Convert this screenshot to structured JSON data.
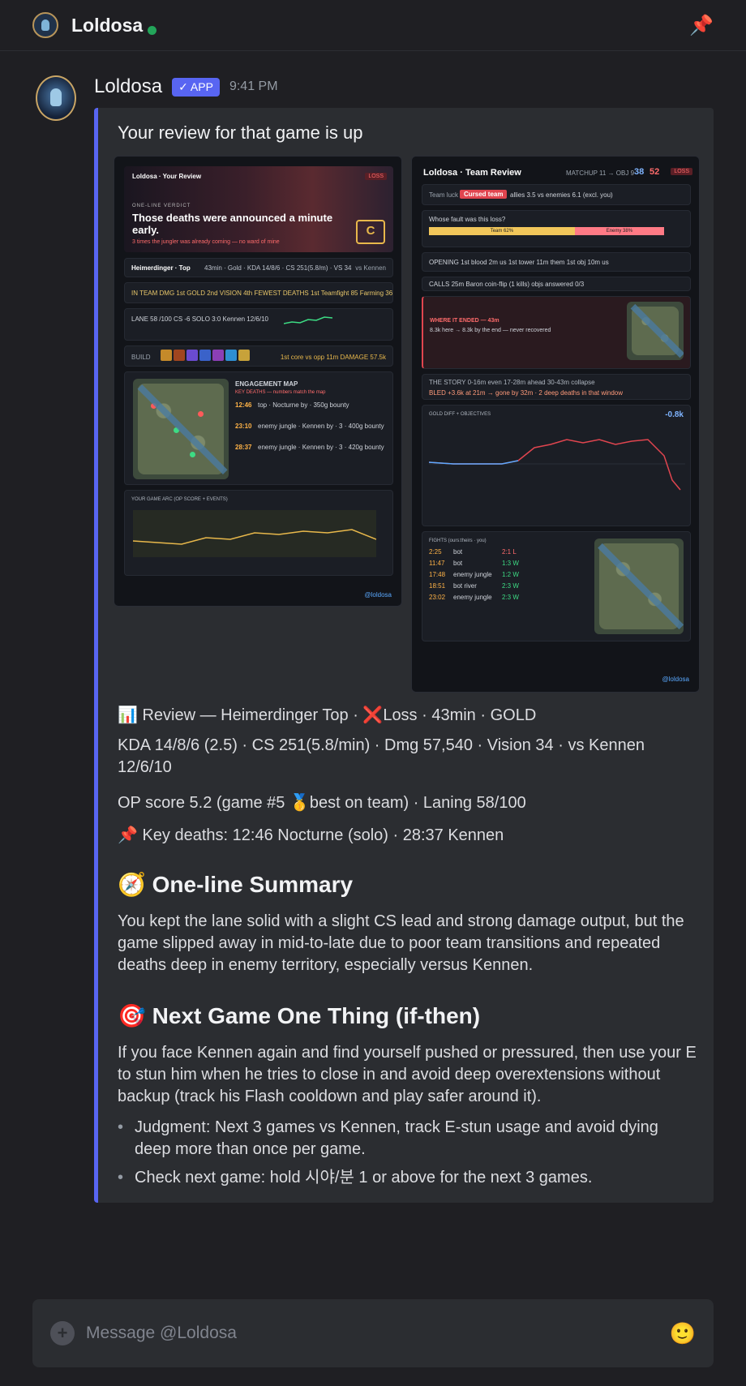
{
  "topbar": {
    "title": "Loldosa"
  },
  "message": {
    "author": "Loldosa",
    "badge": "✓ APP",
    "time": "9:41 PM",
    "intro": "Your review for that game is up",
    "stats_line1": "📊 Review — Heimerdinger Top · ❌Loss · 43min · GOLD",
    "stats_line2": "KDA 14/8/6 (2.5) · CS 251(5.8/min) · Dmg 57,540 · Vision 34 · vs Kennen 12/6/10",
    "stats_line3": "OP score 5.2 (game #5 🥇best on team) · Laning 58/100",
    "stats_line4": "📌 Key deaths: 12:46 Nocturne (solo) · 28:37 Kennen",
    "summary_heading": "One-line Summary",
    "summary_icon": "🧭",
    "summary_text": "You kept the lane solid with a slight CS lead and strong damage output, but the game slipped away in mid-to-late due to poor team transitions and repeated deaths deep in enemy territory, especially versus Kennen.",
    "next_heading": "Next Game One Thing (if-then)",
    "next_icon": "🎯",
    "next_text": "If you face Kennen again and find yourself pushed or pressured, then use your E to stun him when he tries to close in and avoid deep overextensions without backup (track his Flash cooldown and play safer around it).",
    "bullets": [
      "Judgment: Next 3 games vs Kennen, track E-stun usage and avoid dying deep more than once per game.",
      "Check next game: hold 시야/분 1 or above for the next 3 games."
    ]
  },
  "card1": {
    "brand": "Loldosa · Your Review",
    "loss": "LOSS",
    "verdict_label": "ONE-LINE VERDICT",
    "verdict": "Those deaths were announced a minute early.",
    "verdict_sub": "3 times the jungler was already coming — no ward of mine",
    "grade": "C",
    "grade_sub": "op 5.2",
    "champ_line": "Heimerdinger · Top",
    "champ_meta": "43min · Gold · KDA 14/8/6 · CS 251(5.8/m) · VS 34",
    "vs": "vs Kennen",
    "team_line": "IN TEAM   DMG 1st   GOLD 2nd   VISION 4th   FEWEST DEATHS 1st   Teamfight 85   Farming 36",
    "lane_line": "LANE  58 /100   CS -6   SOLO 3:0   Kennen 12/6/10",
    "build_label": "BUILD",
    "build_meta": "1st core vs opp 11m   DAMAGE 57.5k",
    "engagement_title": "ENGAGEMENT MAP",
    "key_deaths": "KEY DEATHS — numbers match the map",
    "deaths": [
      {
        "time": "12:46",
        "text": "top · Nocturne by · 350g bounty"
      },
      {
        "time": "23:10",
        "text": "enemy jungle · Kennen by · 3 · 400g bounty"
      },
      {
        "time": "28:37",
        "text": "enemy jungle · Kennen by · 3 · 420g bounty"
      }
    ],
    "arc_title": "YOUR GAME ARC (OP SCORE + EVENTS)",
    "footer": "@loldosa"
  },
  "card2": {
    "brand": "Loldosa · Team Review",
    "matchup": "MATCHUP 11 → OBJ 9",
    "score_a": "38",
    "score_b": "52",
    "loss": "LOSS",
    "team_luck": "Team luck",
    "cursed": "Cursed team",
    "luck_text": "allies 3.5 vs enemies 6.1 (excl. you)",
    "fault_q": "Whose fault was this loss?",
    "team_pct": "Team 62%",
    "enemy_pct": "Enemy 38%",
    "opening": "OPENING  1st blood 2m us   1st tower 11m them   1st obj 10m us",
    "calls": "CALLS  25m Baron coin-flip (1 kills)  objs answered 0/3",
    "where_ended": "WHERE IT ENDED — 43m",
    "where_text": "8.3k here → 8.3k by the end — never recovered",
    "story": "THE STORY   0-16m even   17-28m ahead   30-43m collapse",
    "bled": "BLED  +3.6k at 21m → gone by 32m · 2 deep deaths in that window",
    "gold_title": "GOLD DIFF + OBJECTIVES",
    "gold_value": "-0.8k",
    "fights_title": "FIGHTS (ours:theirs · you)",
    "fights": [
      {
        "n": "1",
        "time": "2:25",
        "where": "bot",
        "score": "2:1 L"
      },
      {
        "n": "2",
        "time": "11:47",
        "where": "bot",
        "score": "1:3 W"
      },
      {
        "n": "3",
        "time": "17:48",
        "where": "enemy jungle",
        "score": "1:2 W"
      },
      {
        "n": "4",
        "time": "18:51",
        "where": "bot river",
        "score": "2:3 W"
      },
      {
        "n": "5",
        "time": "23:02",
        "where": "enemy jungle",
        "score": "2:3 W"
      }
    ],
    "footer": "@loldosa"
  },
  "composer": {
    "placeholder": "Message @Loldosa"
  }
}
